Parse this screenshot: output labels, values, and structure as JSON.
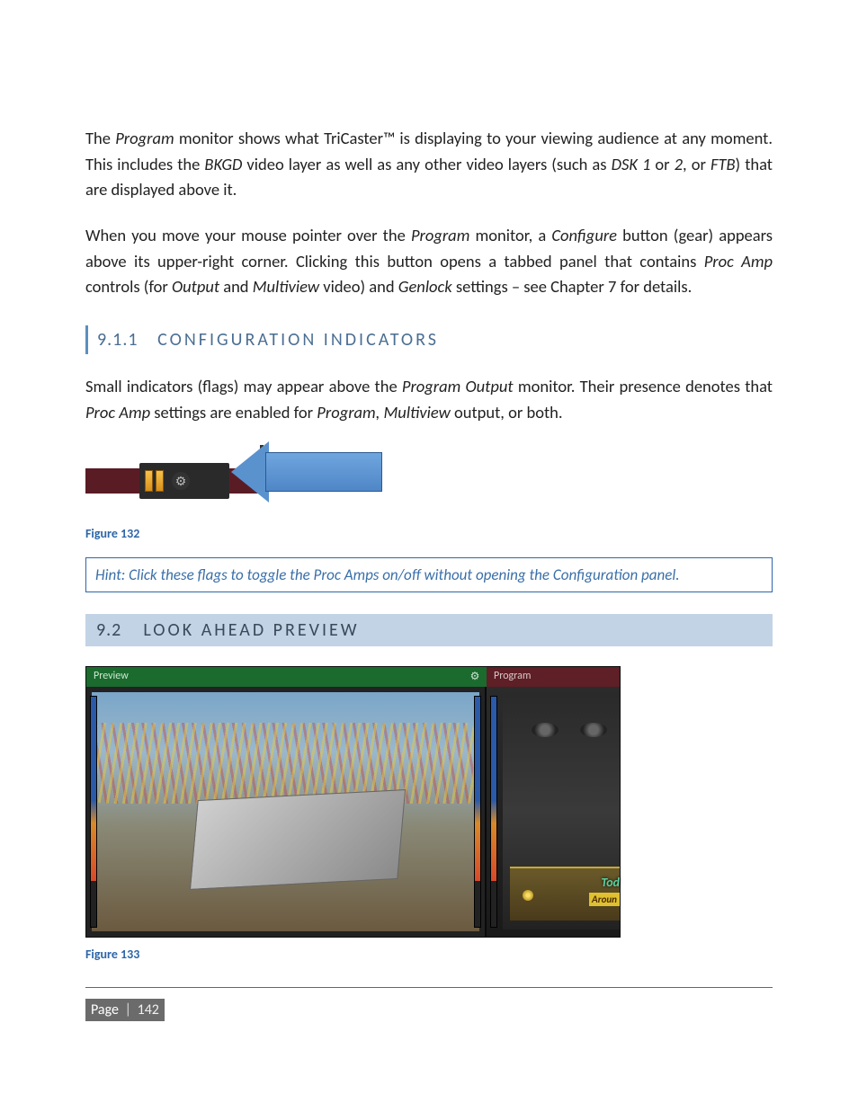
{
  "para1": "The Program monitor shows what TriCaster™ is displaying to your viewing audience at any moment.  This includes the BKGD video layer as well as any other video layers (such as DSK 1 or 2, or FTB) that are displayed above it.",
  "para2": "When you move your mouse pointer over the Program monitor, a Configure button (gear) appears above its upper-right corner.  Clicking this button opens a tabbed panel that contains Proc Amp controls (for Output and Multiview video) and Genlock settings – see Chapter 7 for details.",
  "section_911": {
    "num": "9.1.1",
    "title": "CONFIGURATION INDICATORS"
  },
  "para3": "Small indicators (flags) may appear above the Program Output monitor.  Their presence denotes that Proc Amp settings are enabled for Program, Multiview output, or both.",
  "figure132": {
    "caption": "Figure 132",
    "flag_icons": [
      "proc-amp-flag",
      "proc-amp-flag"
    ],
    "gear_icon": "gear-icon",
    "arrow_color": "#5a92ce"
  },
  "hint": "Hint: Click these flags to toggle the Proc Amps on/off without opening the Configuration panel.",
  "section_92": {
    "num": "9.2",
    "title": "LOOK AHEAD PREVIEW"
  },
  "figure133": {
    "caption": "Figure 133",
    "preview_label": "Preview",
    "program_label": "Program",
    "gear_icon": "gear-icon",
    "overlay_text_top": "Tod",
    "overlay_text_bottom": "Aroun",
    "preview_header_color": "#1b6b2f",
    "program_header_color": "#5e1f26"
  },
  "footer": {
    "page_word": "Page",
    "sep": "|",
    "num": "142"
  }
}
